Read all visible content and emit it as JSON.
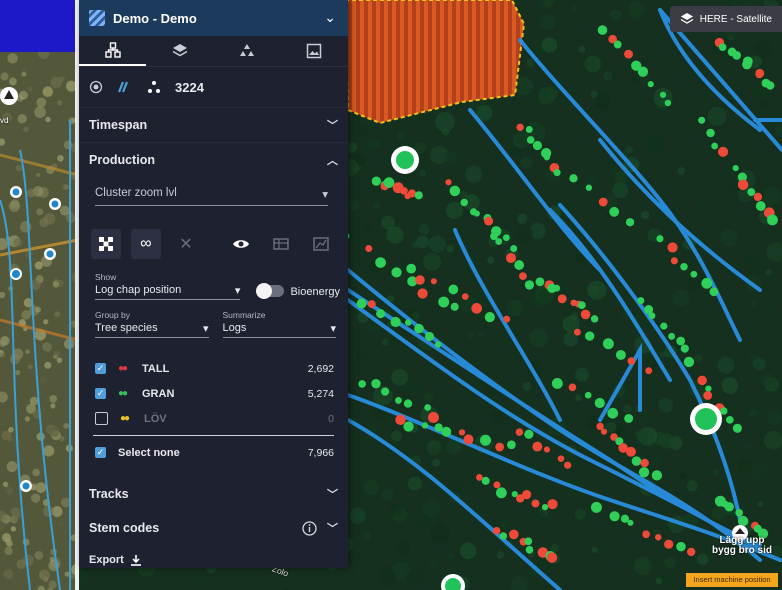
{
  "header": {
    "title": "Demo - Demo"
  },
  "tabs": [
    {
      "icon": "machine-network-icon"
    },
    {
      "icon": "layers-icon"
    },
    {
      "icon": "cluster-icon"
    },
    {
      "icon": "image-icon"
    }
  ],
  "mode_row": {
    "count": "3224"
  },
  "sections": {
    "timespan": "Timespan",
    "production": "Production",
    "tracks": "Tracks",
    "stem_codes": "Stem codes",
    "export": "Export"
  },
  "cluster_select": "Cluster zoom lvl",
  "show": {
    "label": "Show",
    "value": "Log chap position",
    "toggle_label": "Bioenergy"
  },
  "group_by": {
    "label": "Group by",
    "value": "Tree species"
  },
  "summarize": {
    "label": "Summarize",
    "value": "Logs"
  },
  "species": [
    {
      "label": "TALL",
      "value": "2,692",
      "checked": true,
      "color": "#e03b3b"
    },
    {
      "label": "GRAN",
      "value": "5,274",
      "checked": true,
      "color": "#3bbf5a"
    },
    {
      "label": "LÖV",
      "value": "0",
      "checked": false,
      "color": "#e8c21e"
    }
  ],
  "select_none": {
    "label": "Select none",
    "value": "7,966"
  },
  "map": {
    "basemap_label": "HERE - Satellite",
    "road_label_1": "Lägg upp",
    "road_label_2": "bygg bro sid",
    "position_label": "Insert machine position",
    "left_label": "vd",
    "chip_label": "Zolo"
  }
}
